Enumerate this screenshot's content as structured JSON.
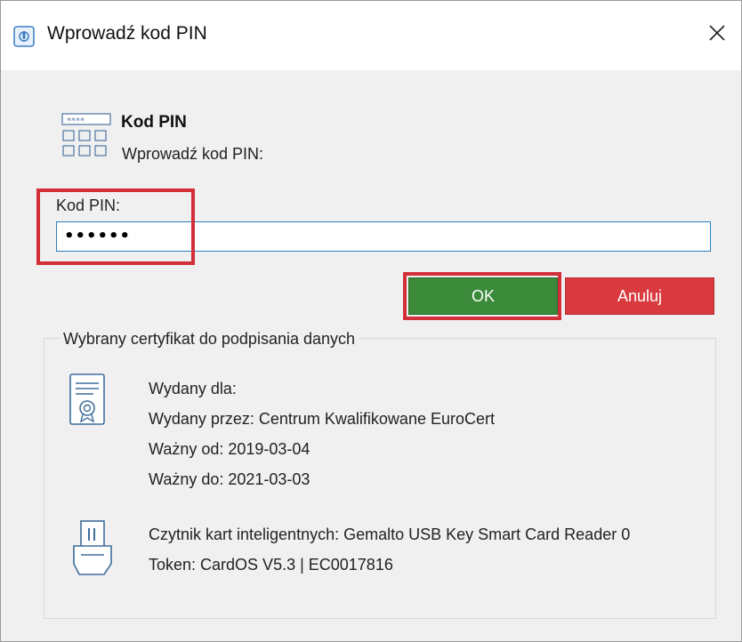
{
  "window": {
    "title": "Wprowadź kod PIN",
    "close_glyph": "✕"
  },
  "header": {
    "title": "Kod PIN",
    "subtitle": "Wprowadź kod PIN:",
    "icon": "pin-pad-icon"
  },
  "pin": {
    "label": "Kod PIN:",
    "value": "••••••"
  },
  "buttons": {
    "ok": "OK",
    "cancel": "Anuluj"
  },
  "certificate": {
    "group_title": "Wybrany certyfikat do podpisania danych",
    "issued_to": "Wydany dla:",
    "issued_by": "Wydany przez: Centrum Kwalifikowane EuroCert",
    "valid_from": "Ważny od: 2019-03-04",
    "valid_to": "Ważny do: 2021-03-03"
  },
  "reader": {
    "reader": "Czytnik kart inteligentnych: Gemalto USB Key Smart Card Reader 0",
    "token": "Token: CardOS V5.3 | EC0017816"
  },
  "colors": {
    "ok": "#3a8a3a",
    "cancel": "#d93a3f",
    "highlight": "#d32f3a",
    "input_border": "#2a7fbf"
  }
}
